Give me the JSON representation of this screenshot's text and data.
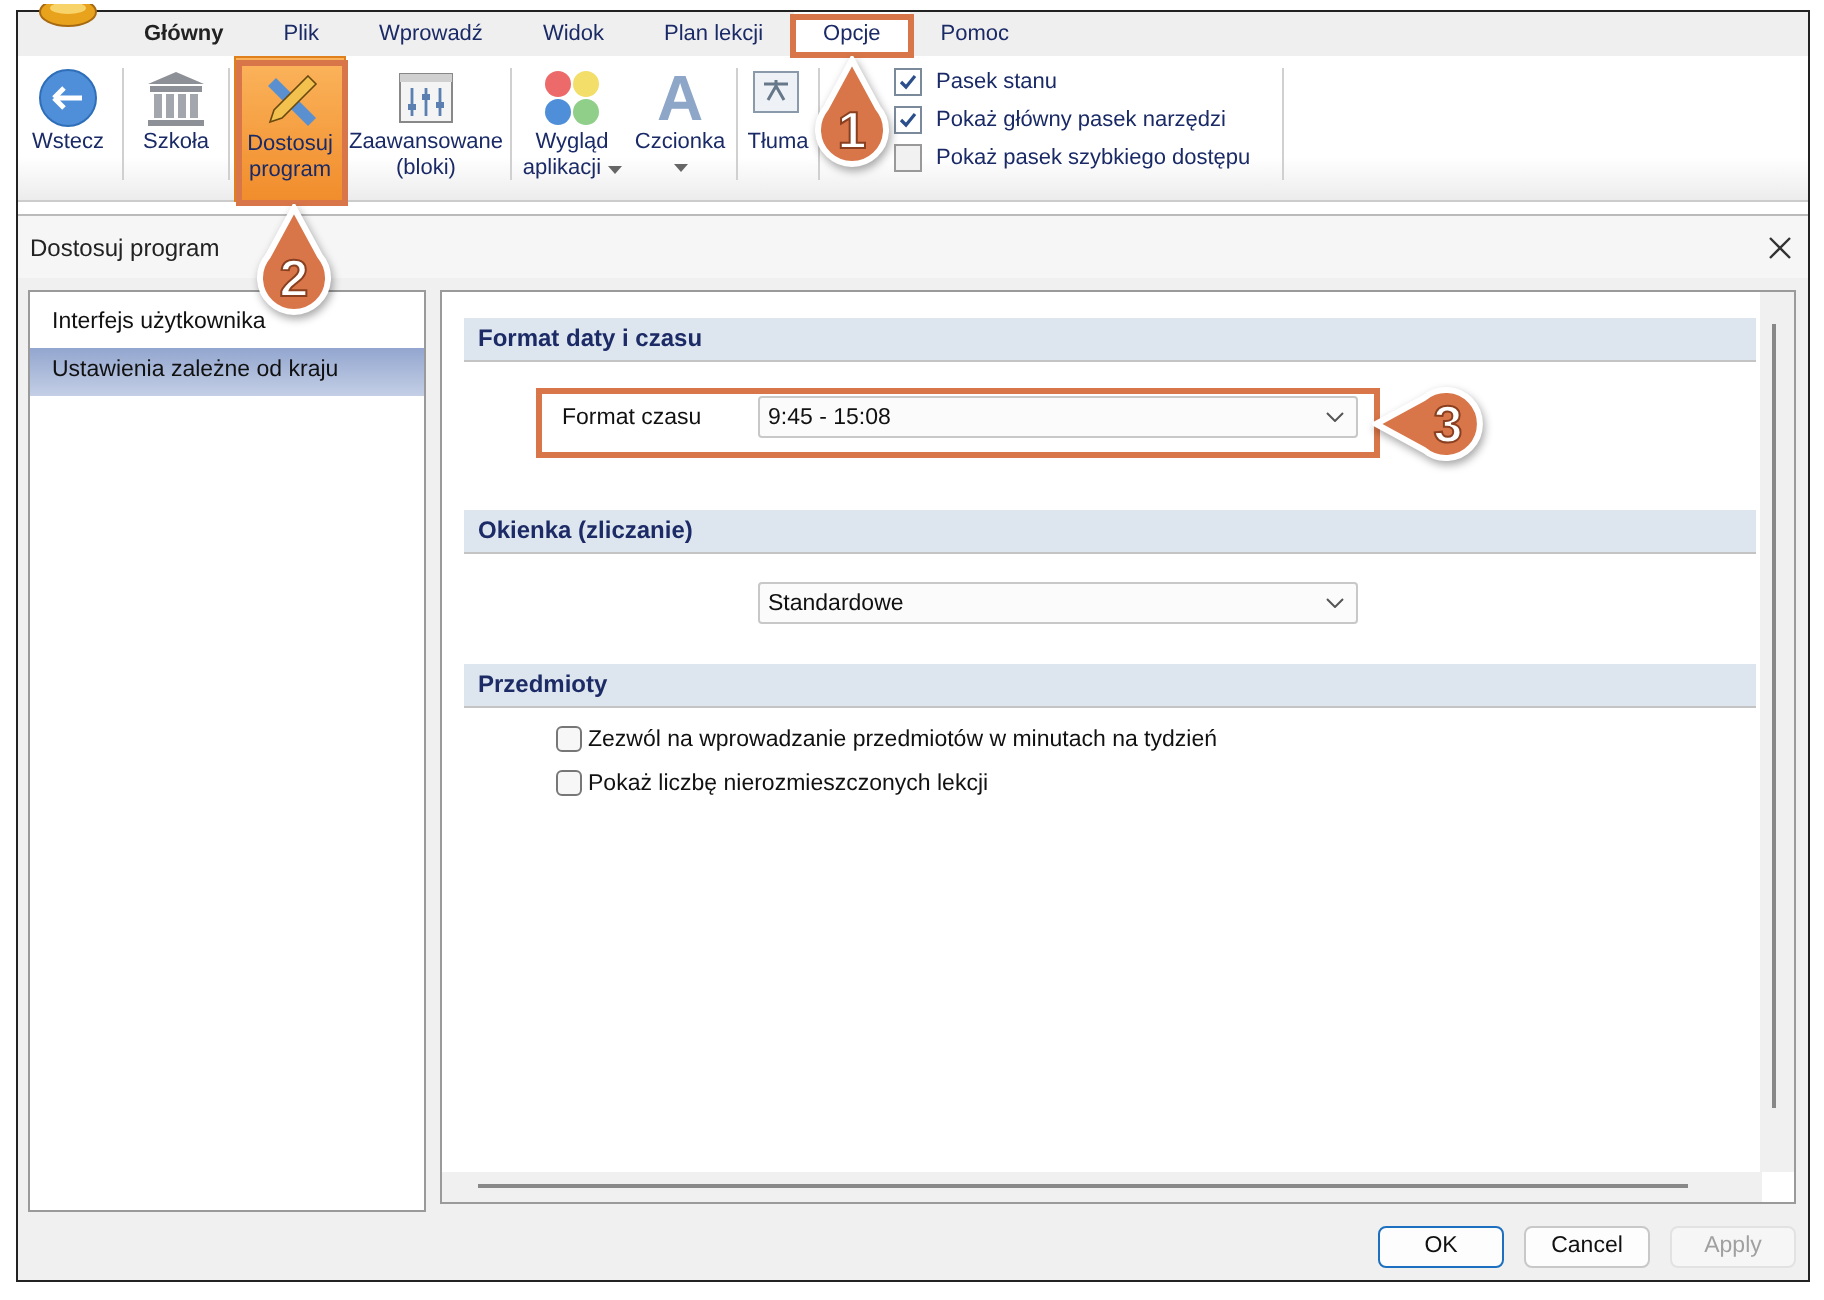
{
  "ribbon_tabs": [
    {
      "label": "Główny",
      "selected": false,
      "bold": true
    },
    {
      "label": "Plik",
      "selected": false,
      "bold": false
    },
    {
      "label": "Wprowadź",
      "selected": false,
      "bold": false
    },
    {
      "label": "Widok",
      "selected": false,
      "bold": false
    },
    {
      "label": "Plan lekcji",
      "selected": false,
      "bold": false
    },
    {
      "label": "Opcje",
      "selected": true,
      "bold": false
    },
    {
      "label": "Pomoc",
      "selected": false,
      "bold": false
    }
  ],
  "ribbon_groups": [
    [
      {
        "kind": "back",
        "lines": [
          "Wstecz"
        ],
        "selected": false
      }
    ],
    [
      {
        "kind": "school",
        "lines": [
          "Szkoła"
        ],
        "selected": false
      }
    ],
    [
      {
        "kind": "customize",
        "lines": [
          "Dostosuj",
          "program"
        ],
        "selected": true
      },
      {
        "kind": "advanced",
        "lines": [
          "Zaawansowane",
          "(bloki)"
        ],
        "selected": false
      }
    ],
    [
      {
        "kind": "colors",
        "lines": [
          "Wygląd",
          "aplikacji"
        ],
        "selected": false,
        "dropdown": true
      },
      {
        "kind": "font",
        "glyph": "A",
        "lines": [
          "Czcionka"
        ],
        "selected": false,
        "dropdown": true
      }
    ],
    [
      {
        "kind": "translate",
        "lines": [
          "Tłuma"
        ],
        "selected": false
      }
    ]
  ],
  "ribbon_checks": [
    {
      "label": "Pasek stanu",
      "checked": true
    },
    {
      "label": "Pokaż główny pasek narzędzi",
      "checked": true
    },
    {
      "label": "Pokaż pasek szybkiego dostępu",
      "checked": false
    }
  ],
  "dialog": {
    "title": "Dostosuj program",
    "nav": [
      {
        "label": "Interfejs użytkownika",
        "selected": false
      },
      {
        "label": "Ustawienia zależne od kraju",
        "selected": true
      }
    ],
    "sections": [
      {
        "title": "Format daty i czasu",
        "fields": [
          {
            "kind": "select",
            "label": "Format czasu",
            "value": "9:45 - 15:08"
          }
        ]
      },
      {
        "title": "Okienka (zliczanie)",
        "fields": [
          {
            "kind": "select",
            "value": "Standardowe"
          }
        ]
      },
      {
        "title": "Przedmioty",
        "fields": [
          {
            "kind": "checkbox",
            "label": "Zezwól na wprowadzanie przedmiotów w minutach na tydzień",
            "checked": false
          },
          {
            "kind": "checkbox",
            "label": "Pokaż liczbę nierozmieszczonych lekcji",
            "checked": false
          }
        ]
      }
    ],
    "buttons": [
      {
        "label": "OK",
        "default": true,
        "disabled": false
      },
      {
        "label": "Cancel",
        "default": false,
        "disabled": false
      },
      {
        "label": "Apply",
        "default": false,
        "disabled": true
      }
    ]
  },
  "callouts": [
    {
      "number": "1"
    },
    {
      "number": "2"
    },
    {
      "number": "3"
    }
  ]
}
